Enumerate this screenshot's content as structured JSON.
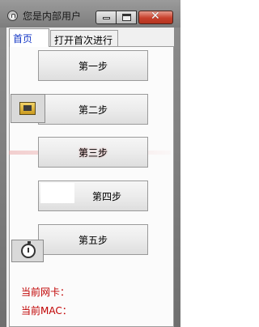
{
  "window": {
    "title": "您是内部用户",
    "close_glyph": "✕"
  },
  "tabs": [
    {
      "label": "首页",
      "active": true
    },
    {
      "label": "打开首次进行",
      "active": false
    }
  ],
  "steps": [
    {
      "label": "第一步"
    },
    {
      "label": "第二步"
    },
    {
      "label": "第三步"
    },
    {
      "label": "第四步"
    },
    {
      "label": "第五步"
    }
  ],
  "info": {
    "nic_label": "当前网卡：",
    "mac_label": "当前MAC："
  },
  "icons": {
    "tray": "tray-icon",
    "timer": "stopwatch-icon"
  },
  "colors": {
    "tab_active_text": "#1538c6",
    "info_text": "#c00000",
    "close_button": "#c8402c"
  }
}
